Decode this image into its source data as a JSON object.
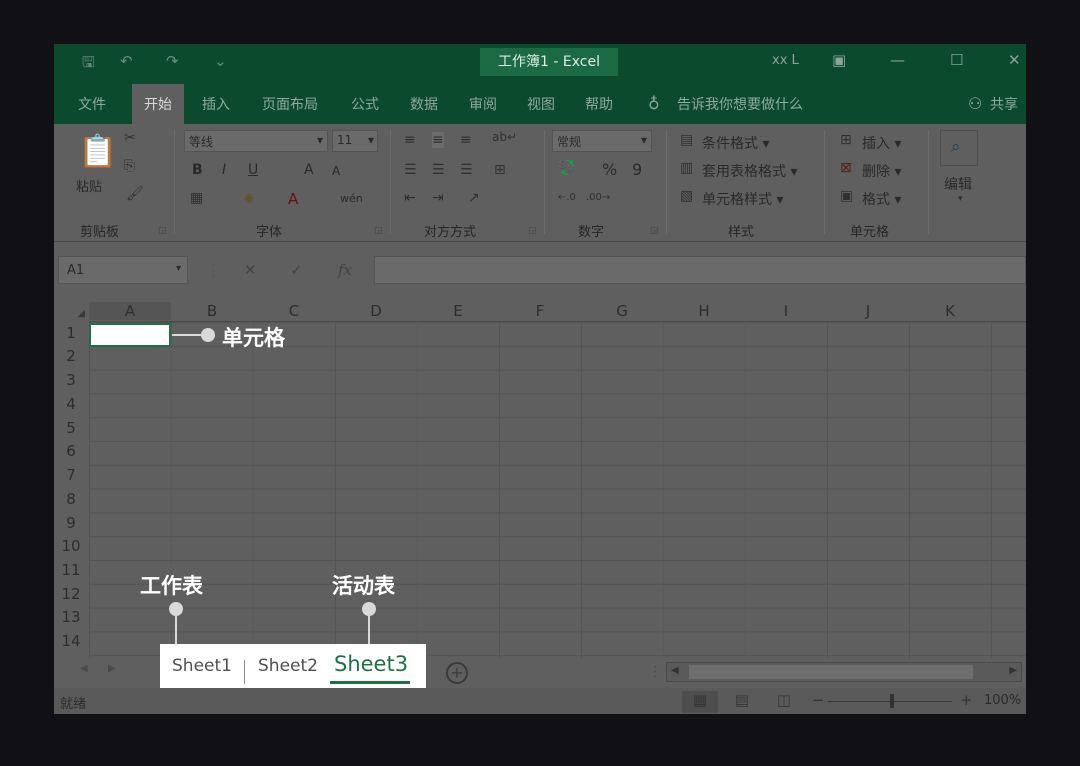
{
  "titlebar": {
    "title": "工作簿1  -  Excel",
    "user": "xx L",
    "save_glyph": "🖫",
    "undo_glyph": "↶",
    "redo_glyph": "↷",
    "customize_glyph": "⌄",
    "ribbon_display_glyph": "▣",
    "minimize_glyph": "—",
    "maximize_glyph": "☐",
    "close_glyph": "✕"
  },
  "tabs": [
    "文件",
    "开始",
    "插入",
    "页面布局",
    "公式",
    "数据",
    "审阅",
    "视图",
    "帮助"
  ],
  "tellme": "告诉我你想要做什么",
  "share": "共享",
  "ribbon": {
    "clipboard": {
      "label": "剪贴板",
      "paste": "粘贴"
    },
    "font": {
      "label": "字体",
      "name": "等线",
      "size": "11",
      "bold": "B",
      "italic": "I",
      "underline": "U",
      "grow": "A",
      "shrink": "A",
      "font_color": "A",
      "phonetic": "wén"
    },
    "alignment": {
      "label": "对方方式"
    },
    "number": {
      "label": "数字",
      "format": "常规",
      "percent": "%",
      "comma": "9"
    },
    "styles": {
      "label": "样式",
      "conditional": "条件格式",
      "table": "套用表格格式",
      "cell_styles": "单元格样式"
    },
    "cells": {
      "label": "单元格",
      "insert": "插入",
      "delete": "删除",
      "format": "格式"
    },
    "editing": {
      "label": "编辑"
    }
  },
  "formula_bar": {
    "name_box": "A1",
    "cancel": "✕",
    "enter": "✓",
    "fx": "fx"
  },
  "columns": [
    "A",
    "B",
    "C",
    "D",
    "E",
    "F",
    "G",
    "H",
    "I",
    "J",
    "K"
  ],
  "rows": [
    "1",
    "2",
    "3",
    "4",
    "5",
    "6",
    "7",
    "8",
    "9",
    "10",
    "11",
    "12",
    "13",
    "14"
  ],
  "callouts": {
    "cell": "单元格",
    "worksheet": "工作表",
    "active_sheet": "活动表"
  },
  "sheets": [
    "Sheet1",
    "Sheet2",
    "Sheet3"
  ],
  "active_sheet": "Sheet3",
  "status": {
    "ready": "就绪",
    "zoom": "100%"
  },
  "colors": {
    "ribbon_green": "#0c4a2e",
    "excel_green": "#1e7145",
    "dim_overlay": "#5f5f5f"
  }
}
